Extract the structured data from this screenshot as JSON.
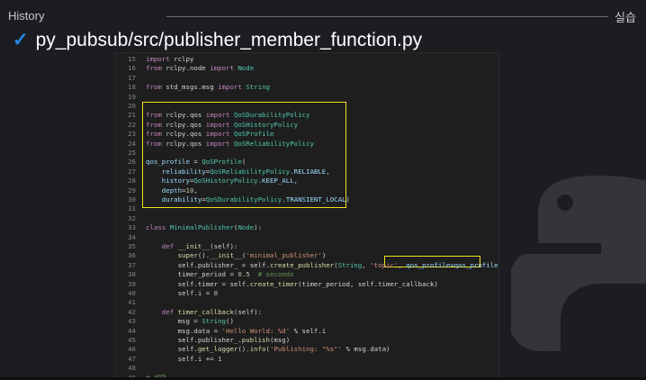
{
  "header": {
    "section": "History",
    "right_title": "실습"
  },
  "page": {
    "check_glyph": "✓",
    "title": "py_pubsub/src/publisher_member_function.py"
  },
  "colors": {
    "keyword": "#c586c0",
    "module": "#4ec9b0",
    "class": "#4ec9b0",
    "function": "#dcdcaa",
    "string": "#ce9178",
    "number": "#b5cea8",
    "comment": "#6a9955",
    "param": "#9cdcfe",
    "default": "#d4d4d4",
    "highlight": "#f2e01d"
  },
  "code": {
    "lines": [
      {
        "n": "15",
        "segs": [
          [
            "import ",
            "keyword"
          ],
          [
            "rclpy",
            "default"
          ]
        ]
      },
      {
        "n": "16",
        "segs": [
          [
            "from ",
            "keyword"
          ],
          [
            "rclpy.node ",
            "default"
          ],
          [
            "import ",
            "keyword"
          ],
          [
            "Node",
            "class"
          ]
        ]
      },
      {
        "n": "17",
        "segs": []
      },
      {
        "n": "18",
        "segs": [
          [
            "from ",
            "keyword"
          ],
          [
            "std_msgs.msg ",
            "default"
          ],
          [
            "import ",
            "keyword"
          ],
          [
            "String",
            "class"
          ]
        ]
      },
      {
        "n": "19",
        "segs": []
      },
      {
        "n": "20",
        "segs": []
      },
      {
        "n": "21",
        "segs": [
          [
            "from ",
            "keyword"
          ],
          [
            "rclpy.qos ",
            "default"
          ],
          [
            "import ",
            "keyword"
          ],
          [
            "QoSDurabilityPolicy",
            "class"
          ]
        ]
      },
      {
        "n": "22",
        "segs": [
          [
            "from ",
            "keyword"
          ],
          [
            "rclpy.qos ",
            "default"
          ],
          [
            "import ",
            "keyword"
          ],
          [
            "QoSHistoryPolicy",
            "class"
          ]
        ]
      },
      {
        "n": "23",
        "segs": [
          [
            "from ",
            "keyword"
          ],
          [
            "rclpy.qos ",
            "default"
          ],
          [
            "import ",
            "keyword"
          ],
          [
            "QoSProfile",
            "class"
          ]
        ]
      },
      {
        "n": "24",
        "segs": [
          [
            "from ",
            "keyword"
          ],
          [
            "rclpy.qos ",
            "default"
          ],
          [
            "import ",
            "keyword"
          ],
          [
            "QoSReliabilityPolicy",
            "class"
          ]
        ]
      },
      {
        "n": "25",
        "segs": []
      },
      {
        "n": "26",
        "segs": [
          [
            "qos_profile ",
            "param"
          ],
          [
            "= ",
            "default"
          ],
          [
            "QoSProfile",
            "class"
          ],
          [
            "(",
            "default"
          ]
        ]
      },
      {
        "n": "27",
        "segs": [
          [
            "    reliability",
            "param"
          ],
          [
            "=",
            "default"
          ],
          [
            "QoSReliabilityPolicy",
            "class"
          ],
          [
            ".RELIABLE,",
            "param"
          ]
        ]
      },
      {
        "n": "28",
        "segs": [
          [
            "    history",
            "param"
          ],
          [
            "=",
            "default"
          ],
          [
            "QoSHistoryPolicy",
            "class"
          ],
          [
            ".KEEP_ALL,",
            "param"
          ]
        ]
      },
      {
        "n": "29",
        "segs": [
          [
            "    depth",
            "param"
          ],
          [
            "=",
            "default"
          ],
          [
            "10",
            "number"
          ],
          [
            ",",
            "default"
          ]
        ]
      },
      {
        "n": "30",
        "segs": [
          [
            "    durability",
            "param"
          ],
          [
            "=",
            "default"
          ],
          [
            "QoSDurabilityPolicy",
            "class"
          ],
          [
            ".TRANSIENT_LOCAL)",
            "param"
          ]
        ]
      },
      {
        "n": "31",
        "segs": []
      },
      {
        "n": "32",
        "segs": []
      },
      {
        "n": "33",
        "segs": [
          [
            "class ",
            "keyword"
          ],
          [
            "MinimalPublisher",
            "class"
          ],
          [
            "(",
            "default"
          ],
          [
            "Node",
            "class"
          ],
          [
            "):",
            "default"
          ]
        ]
      },
      {
        "n": "34",
        "segs": []
      },
      {
        "n": "35",
        "segs": [
          [
            "    def ",
            "keyword"
          ],
          [
            "__init__",
            "function"
          ],
          [
            "(self):",
            "default"
          ]
        ]
      },
      {
        "n": "36",
        "segs": [
          [
            "        super",
            "function"
          ],
          [
            "().",
            "default"
          ],
          [
            "__init__",
            "function"
          ],
          [
            "(",
            "default"
          ],
          [
            "'minimal_publisher'",
            "string"
          ],
          [
            ")",
            "default"
          ]
        ]
      },
      {
        "n": "37",
        "segs": [
          [
            "        self.publisher_ = self.",
            "default"
          ],
          [
            "create_publisher",
            "function"
          ],
          [
            "(",
            "default"
          ],
          [
            "String",
            "class"
          ],
          [
            ", ",
            "default"
          ],
          [
            "'topic'",
            "string"
          ],
          [
            ", ",
            "default"
          ],
          [
            "qos_profile=qos_profile",
            "param"
          ],
          [
            ")",
            "default"
          ]
        ]
      },
      {
        "n": "38",
        "segs": [
          [
            "        timer_period = ",
            "default"
          ],
          [
            "0.5",
            "number"
          ],
          [
            "  # seconds",
            "comment"
          ]
        ]
      },
      {
        "n": "39",
        "segs": [
          [
            "        self.timer = self.",
            "default"
          ],
          [
            "create_timer",
            "function"
          ],
          [
            "(timer_period, self.timer_callback)",
            "default"
          ]
        ]
      },
      {
        "n": "40",
        "segs": [
          [
            "        self.i = ",
            "default"
          ],
          [
            "0",
            "number"
          ]
        ]
      },
      {
        "n": "41",
        "segs": []
      },
      {
        "n": "42",
        "segs": [
          [
            "    def ",
            "keyword"
          ],
          [
            "timer_callback",
            "function"
          ],
          [
            "(self):",
            "default"
          ]
        ]
      },
      {
        "n": "43",
        "segs": [
          [
            "        msg = ",
            "default"
          ],
          [
            "String",
            "class"
          ],
          [
            "()",
            "default"
          ]
        ]
      },
      {
        "n": "44",
        "segs": [
          [
            "        msg.data = ",
            "default"
          ],
          [
            "'Hello World: %d'",
            "string"
          ],
          [
            " % self.i",
            "default"
          ]
        ]
      },
      {
        "n": "45",
        "segs": [
          [
            "        self.publisher_.",
            "default"
          ],
          [
            "publish",
            "function"
          ],
          [
            "(msg)",
            "default"
          ]
        ]
      },
      {
        "n": "46",
        "segs": [
          [
            "        self.",
            "default"
          ],
          [
            "get_logger",
            "function"
          ],
          [
            "().",
            "default"
          ],
          [
            "info",
            "function"
          ],
          [
            "(",
            "default"
          ],
          [
            "'Publishing: \"%s\"'",
            "string"
          ],
          [
            " % msg.data)",
            "default"
          ]
        ]
      },
      {
        "n": "47",
        "segs": [
          [
            "        self.i += ",
            "default"
          ],
          [
            "1",
            "number"
          ]
        ]
      },
      {
        "n": "48",
        "segs": []
      },
      {
        "n": "49",
        "segs": [
          [
            "# 생략",
            "comment"
          ]
        ]
      }
    ]
  }
}
